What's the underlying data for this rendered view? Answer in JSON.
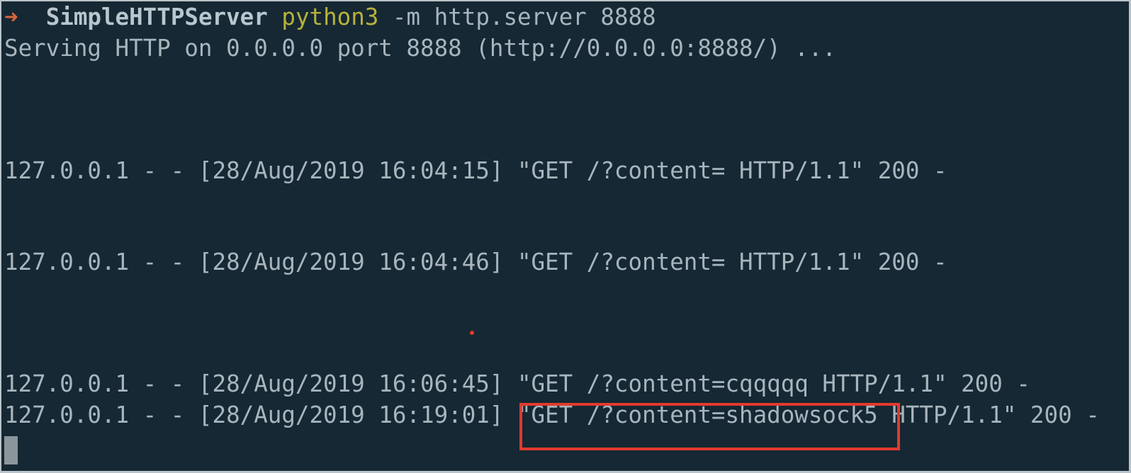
{
  "prompt": {
    "arrow": "➜",
    "directory": "SimpleHTTPServer",
    "command": "python3",
    "arguments": "-m http.server 8888"
  },
  "output": {
    "serving": "Serving HTTP on 0.0.0.0 port 8888 (http://0.0.0.0:8888/) ...",
    "log_lines": [
      "127.0.0.1 - - [28/Aug/2019 16:04:15] \"GET /?content= HTTP/1.1\" 200 -",
      "127.0.0.1 - - [28/Aug/2019 16:04:46] \"GET /?content= HTTP/1.1\" 200 -",
      "127.0.0.1 - - [28/Aug/2019 16:06:45] \"GET /?content=cqqqqq HTTP/1.1\" 200 -",
      "127.0.0.1 - - [28/Aug/2019 16:19:01] \"GET /?content=shadowsock5 HTTP/1.1\" 200 -"
    ]
  },
  "colors": {
    "background": "#152833",
    "text": "#a8b5bd",
    "arrow": "#d8663b",
    "command": "#b7b23c",
    "highlight": "#e23a2e"
  }
}
